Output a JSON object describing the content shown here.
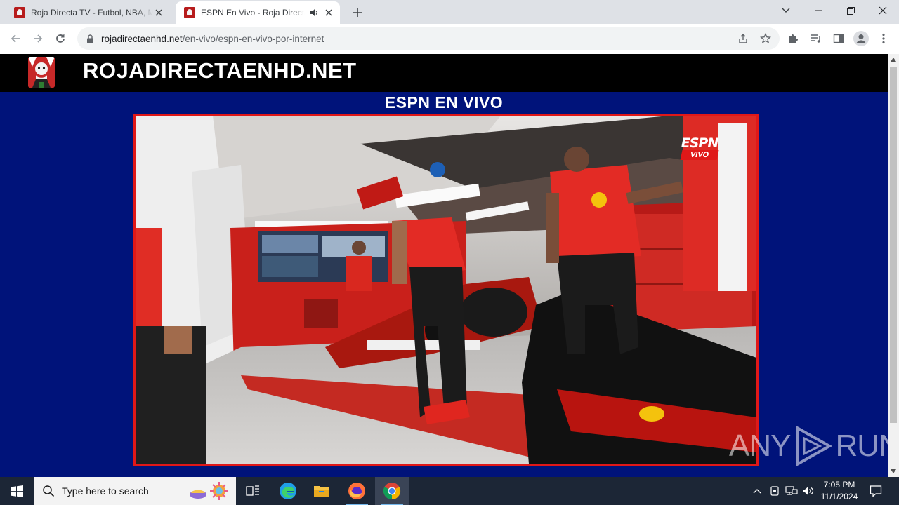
{
  "browser": {
    "tabs": [
      {
        "title": "Roja Directa TV - Futbol, NBA, M",
        "active": false
      },
      {
        "title": "ESPN En Vivo - Roja Directa",
        "active": true
      }
    ],
    "url_host": "rojadirectaenhd.net",
    "url_path": "/en-vivo/espn-en-vivo-por-internet"
  },
  "page": {
    "site_title": "ROJADIRECTAENHD.NET",
    "heading": "ESPN EN VIVO",
    "player": {
      "channel_logo": "ESPN",
      "live_badge": "VIVO"
    }
  },
  "watermark": {
    "text_left": "ANY",
    "text_right": "RUN"
  },
  "taskbar": {
    "search_placeholder": "Type here to search",
    "time": "7:05 PM",
    "date": "11/1/2024"
  },
  "colors": {
    "page_bg": "#00137a",
    "header_bg": "#000000",
    "player_border": "#e01818",
    "taskbar_bg": "#1c2636"
  }
}
